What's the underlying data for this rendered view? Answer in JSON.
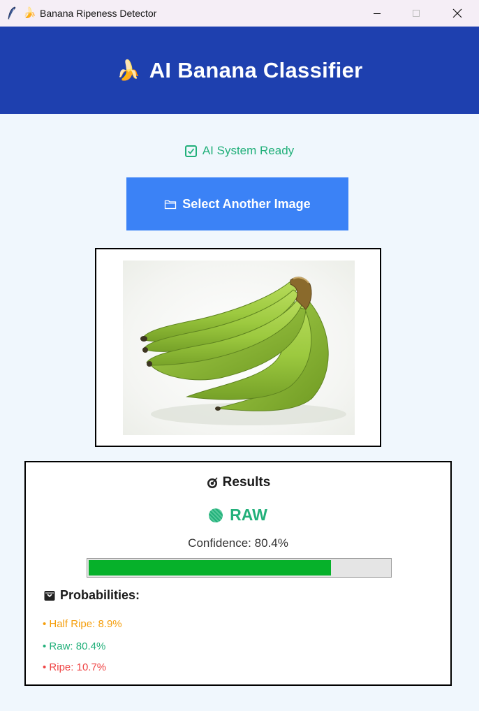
{
  "window": {
    "title": "Banana Ripeness Detector",
    "title_emoji": "🍌",
    "icons": [
      "feather-icon",
      "banana-icon",
      "minimize-icon",
      "maximize-icon",
      "close-icon"
    ]
  },
  "header": {
    "emoji": "🍌",
    "title": "AI Banana Classifier",
    "background": "#1e40af"
  },
  "status": {
    "icon": "check-box-icon",
    "text": "AI System Ready",
    "color": "#22b07a"
  },
  "select_button": {
    "icon": "folder-icon",
    "label": "Select Another Image",
    "background": "#3b82f6"
  },
  "image_preview": {
    "subject": "bunch of green bananas"
  },
  "results": {
    "icon": "target-icon",
    "title": "Results",
    "class_icon": "green-circle-icon",
    "class_label": "RAW",
    "class_color": "#22b07a",
    "confidence_text": "Confidence: 80.4%",
    "confidence_value": 0.804,
    "bar_color": "#06b12a",
    "prob_icon": "box-icon",
    "prob_title": "Probabilities:",
    "probabilities": [
      {
        "text": "• Half Ripe: 8.9%",
        "color": "#f59e0b"
      },
      {
        "text": "• Raw: 80.4%",
        "color": "#22b07a"
      },
      {
        "text": "• Ripe: 10.7%",
        "color": "#ef4444"
      }
    ]
  }
}
